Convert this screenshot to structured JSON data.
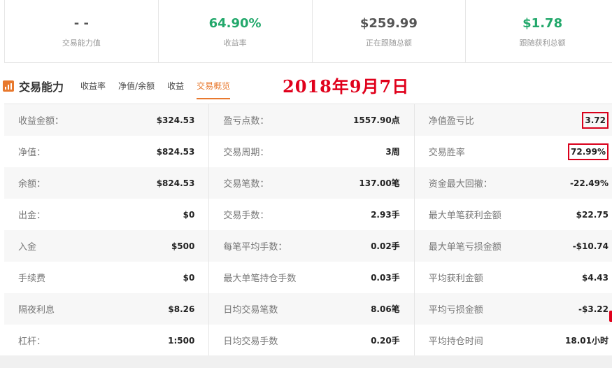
{
  "stats": [
    {
      "value": "- -",
      "label": "交易能力值",
      "green": false
    },
    {
      "value": "64.90%",
      "label": "收益率",
      "green": true
    },
    {
      "value": "$259.99",
      "label": "正在跟随总额",
      "green": false
    },
    {
      "value": "$1.78",
      "label": "跟随获利总额",
      "green": true
    }
  ],
  "section": {
    "title": "交易能力",
    "tabs": [
      "收益率",
      "净值/余额",
      "收益",
      "交易概览"
    ],
    "active_tab": 3,
    "date": "2018年9月7日"
  },
  "table": [
    [
      [
        "收益金额：",
        "$324.53"
      ],
      [
        "盈亏点数：",
        "1557.90点"
      ],
      [
        "净值盈亏比",
        "3.72"
      ]
    ],
    [
      [
        "净值：",
        "$824.53"
      ],
      [
        "交易周期：",
        "3周"
      ],
      [
        "交易胜率",
        "72.99%"
      ]
    ],
    [
      [
        "余额：",
        "$824.53"
      ],
      [
        "交易笔数：",
        "137.00笔"
      ],
      [
        "资金最大回撤：",
        "-22.49%"
      ]
    ],
    [
      [
        "出金：",
        "$0"
      ],
      [
        "交易手数：",
        "2.93手"
      ],
      [
        "最大单笔获利金额",
        "$22.75"
      ]
    ],
    [
      [
        "入金",
        "$500"
      ],
      [
        "每笔平均手数：",
        "0.02手"
      ],
      [
        "最大单笔亏损金额",
        "-$10.74"
      ]
    ],
    [
      [
        "手续费",
        "$0"
      ],
      [
        "最大单笔持仓手数",
        "0.03手"
      ],
      [
        "平均获利金额",
        "$4.43"
      ]
    ],
    [
      [
        "隔夜利息",
        "$8.26"
      ],
      [
        "日均交易笔数",
        "8.06笔"
      ],
      [
        "平均亏损金额",
        "-$3.22"
      ]
    ],
    [
      [
        "杠杆：",
        "1:500"
      ],
      [
        "日均交易手数",
        "0.20手"
      ],
      [
        "平均持仓时间",
        "18.01小时"
      ]
    ]
  ],
  "highlighted": [
    "3.72",
    "72.99%"
  ],
  "colors": {
    "accent": "#e8792e",
    "green": "#22a86b",
    "red": "#e0001b"
  }
}
